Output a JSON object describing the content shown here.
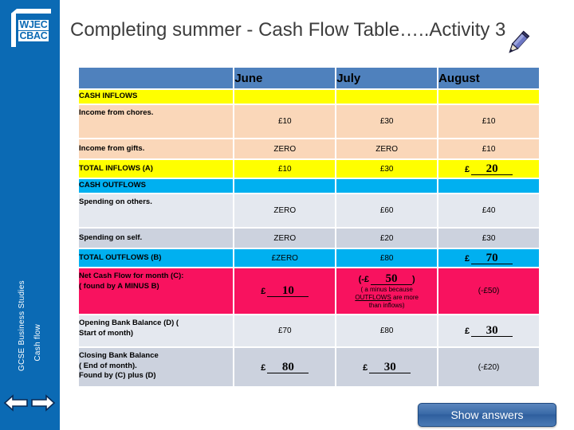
{
  "sidebar": {
    "logo": {
      "line1": "WJEC",
      "line2": "CBAC"
    },
    "course_label": "GCSE Business Studies",
    "topic_label": "Cash flow",
    "prev_label": "Previous slide",
    "next_label": "Next slide"
  },
  "header": {
    "title": "Completing summer - Cash Flow Table…..Activity 3",
    "pencil_icon": "pencil-icon"
  },
  "table": {
    "columns": [
      "",
      "June",
      "July",
      "August"
    ],
    "rows": [
      {
        "label": "CASH INFLOWS",
        "june": "",
        "july": "",
        "august": "",
        "style": "yellow"
      },
      {
        "label": "Income from chores.",
        "june": "£10",
        "july": "£30",
        "august": "£10",
        "style": "peach"
      },
      {
        "label": "Income from gifts.",
        "june": "ZERO",
        "july": "ZERO",
        "august": "£10",
        "style": "peach"
      },
      {
        "label": "TOTAL INFLOWS (A)",
        "june": "£10",
        "july": "£30",
        "august_prefix": "£",
        "august_answer": "20",
        "style": "yellow"
      },
      {
        "label": "CASH OUTFLOWS",
        "june": "",
        "july": "",
        "august": "",
        "style": "cyan"
      },
      {
        "label": "Spending on others.",
        "june": "ZERO",
        "july": "£60",
        "august": "£40",
        "style": "grey1"
      },
      {
        "label": "Spending on self.",
        "june": "ZERO",
        "july": "£20",
        "august": "£30",
        "style": "grey2"
      },
      {
        "label": "TOTAL OUTFLOWS (B)",
        "june": "£ZERO",
        "july": "£80",
        "august_prefix": "£",
        "august_answer": "70",
        "style": "cyan"
      }
    ],
    "net_row": {
      "label_line1": "Net Cash Flow for month (C):",
      "label_line2": "( found by  A MINUS B)",
      "june_prefix": "£",
      "june_answer": "10",
      "july_open": "(-£",
      "july_answer": "50",
      "july_close": ")",
      "july_note_line1": "( a minus because",
      "july_note_underlined": "OUTFLOWS",
      "july_note_line2": "are more",
      "july_note_line3": "than inflows)",
      "august": "(-£50)"
    },
    "opening_row": {
      "label_line1": "Opening Bank Balance (D)        (",
      "label_line2": "Start of month)",
      "june": "£70",
      "july": "£80",
      "august_prefix": "£",
      "august_answer": "30"
    },
    "closing_row": {
      "label_line1": "Closing Bank Balance",
      "label_line2": "( End of month).",
      "label_line3": "Found by (C) plus (D)",
      "june_prefix": "£",
      "june_answer": "80",
      "july_prefix": "£",
      "july_answer": "30",
      "august": "(-£20)"
    }
  },
  "footer": {
    "show_answers_label": "Show answers"
  },
  "colors": {
    "brand_blue": "#0b6ab4",
    "header_blue": "#4f81bd",
    "inflow_yellow": "#ffff00",
    "inflow_peach": "#fad7b9",
    "outflow_cyan": "#00b0f0",
    "net_pink": "#f8125f"
  }
}
